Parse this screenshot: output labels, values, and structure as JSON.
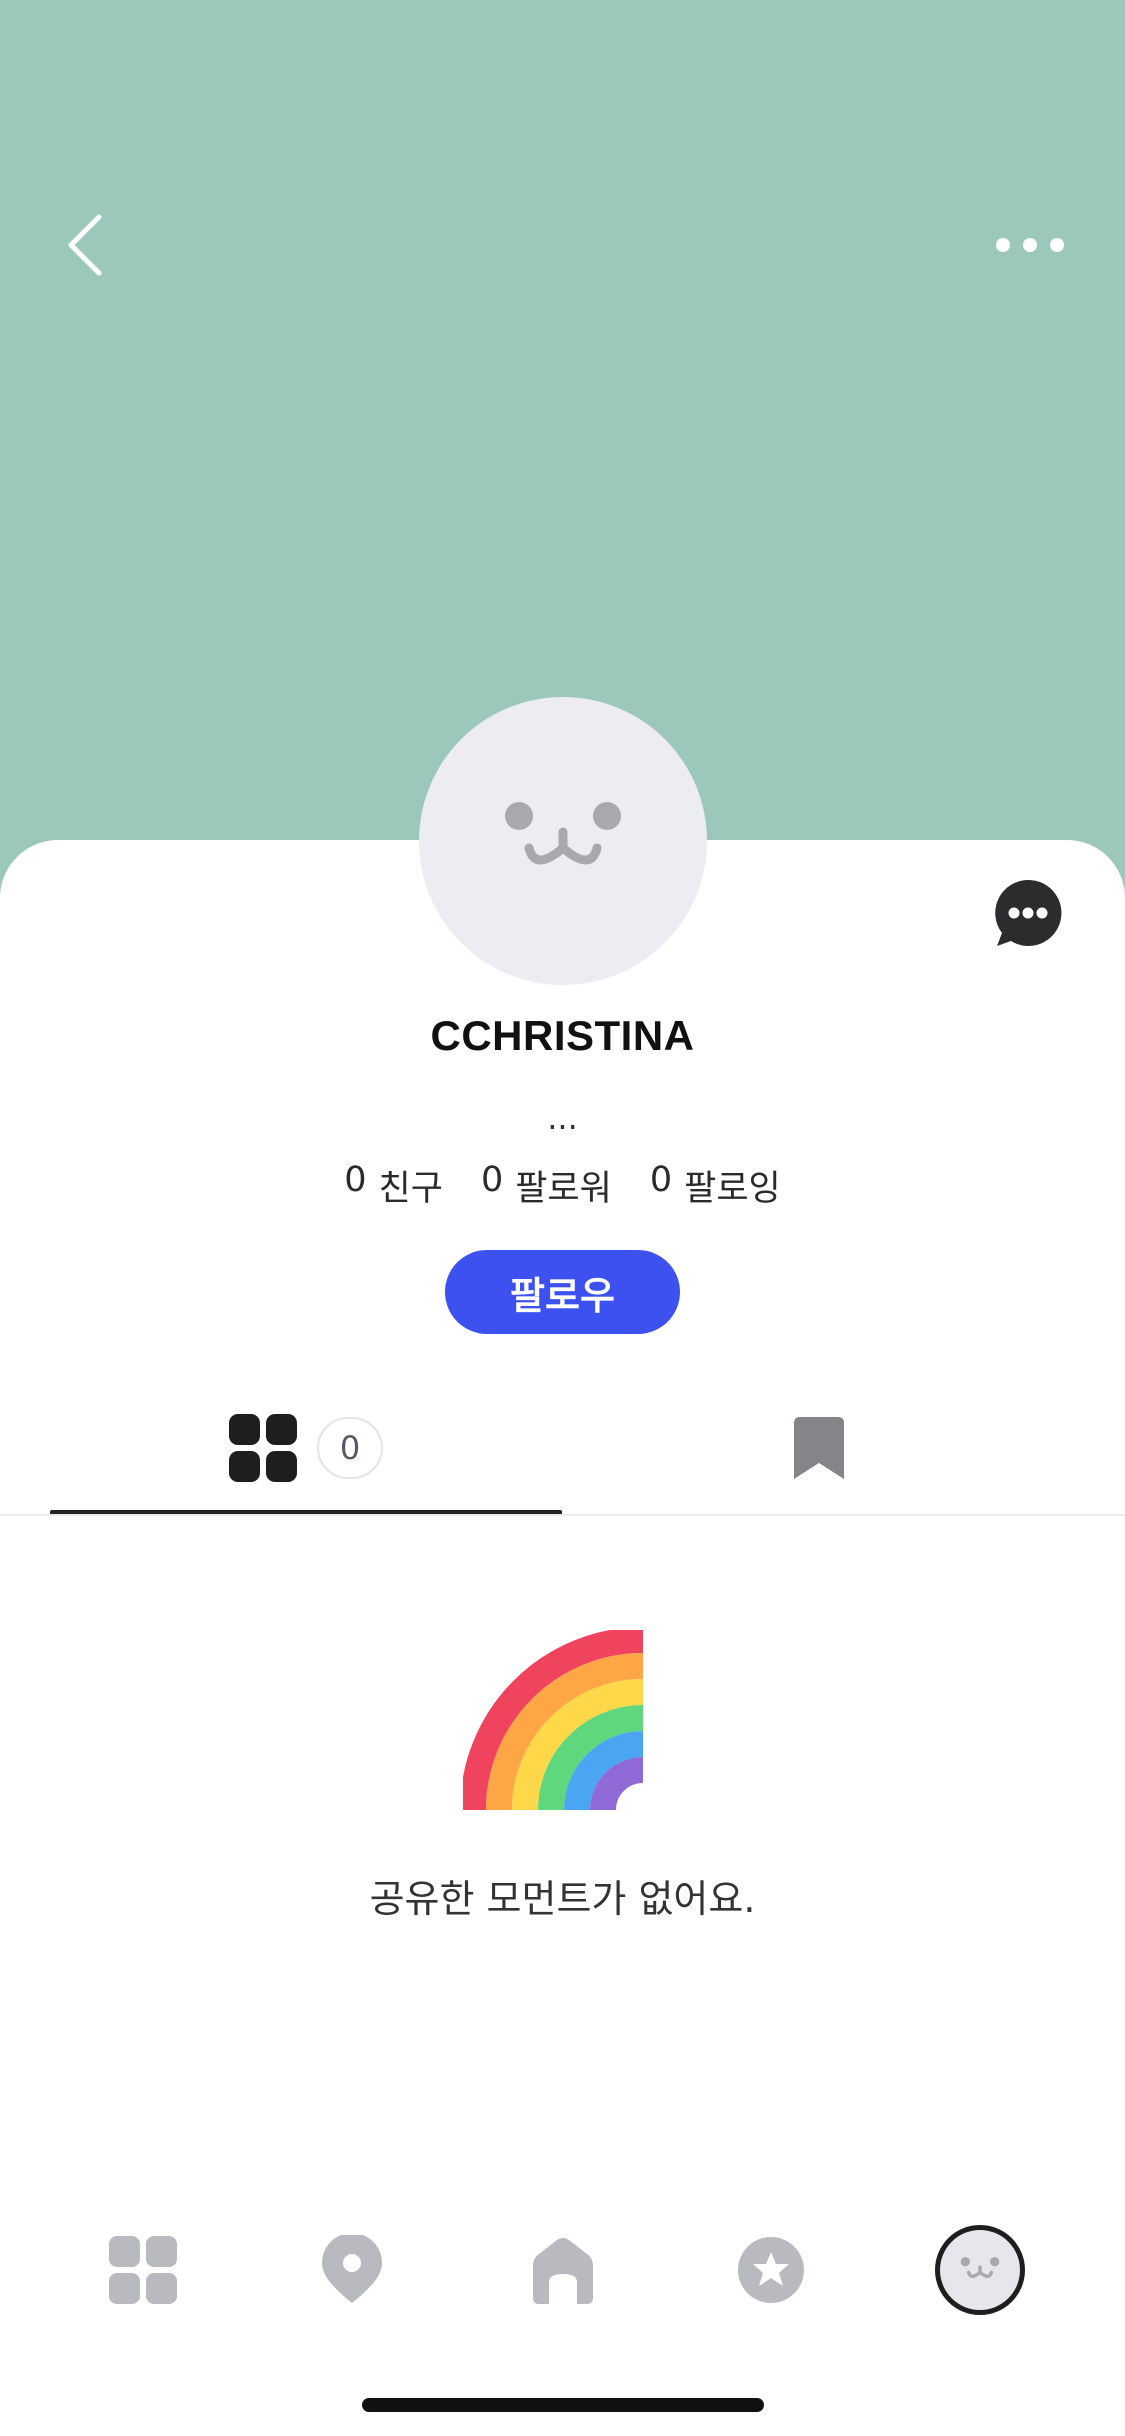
{
  "colors": {
    "cover": "#9cc8bc",
    "accent": "#3d50f0",
    "avatar_bg": "#ececf2",
    "nav_icon": "#b9b9c0"
  },
  "header": {
    "back_icon": "chevron-left-icon",
    "more_icon": "more-horizontal-icon"
  },
  "profile": {
    "username": "CCHRISTINA",
    "bio": "...",
    "chat_icon": "chat-bubble-icon",
    "stats": [
      {
        "count": "0",
        "label": "친구"
      },
      {
        "count": "0",
        "label": "팔로워"
      },
      {
        "count": "0",
        "label": "팔로잉"
      }
    ],
    "follow_label": "팔로우"
  },
  "tabs": {
    "moments": {
      "icon": "grid-icon",
      "count": "0"
    },
    "saved": {
      "icon": "bookmark-icon"
    }
  },
  "empty_state": {
    "illustration": "rainbow-icon",
    "message": "공유한 모먼트가 없어요."
  },
  "bottom_nav": {
    "items": [
      {
        "icon": "grid-icon"
      },
      {
        "icon": "map-pin-icon"
      },
      {
        "icon": "home-icon"
      },
      {
        "icon": "star-badge-icon"
      },
      {
        "icon": "profile-avatar-icon",
        "active": true
      }
    ]
  }
}
